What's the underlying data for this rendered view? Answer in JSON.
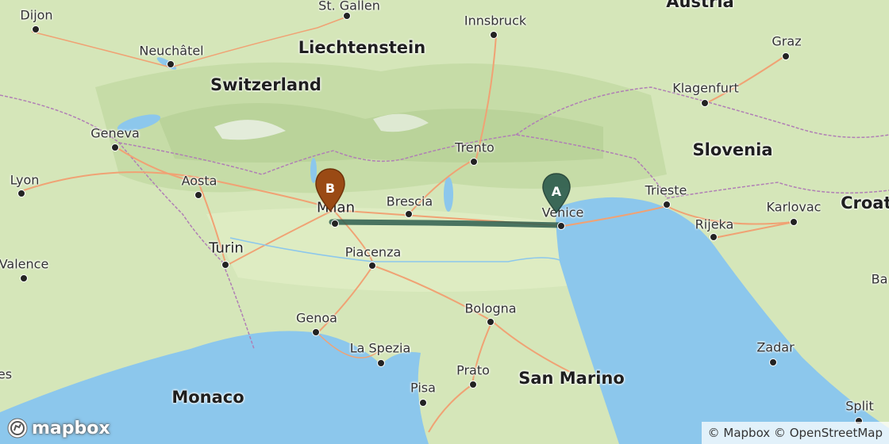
{
  "map": {
    "countries": [
      "Austria",
      "Liechtenstein",
      "Switzerland",
      "Slovenia",
      "Croatia",
      "San Marino",
      "Monaco"
    ],
    "cities": [
      "St. Gallen",
      "Innsbruck",
      "Dijon",
      "Neuchâtel",
      "Graz",
      "Klagenfurt",
      "Geneva",
      "Trento",
      "Lyon",
      "Aosta",
      "Brescia",
      "Trieste",
      "Karlovac",
      "Milan",
      "Venice",
      "Rijeka",
      "Turin",
      "Piacenza",
      "Valence",
      "Bologna",
      "Genoa",
      "La Spezia",
      "Zadar",
      "Prato",
      "Pisa",
      "Split",
      "Ba",
      "es"
    ],
    "route": {
      "from": "Venice",
      "to": "Milan",
      "color": "#2f5e4f"
    },
    "marker_a": {
      "label": "A",
      "color": "#2f5e4f"
    },
    "marker_b": {
      "label": "B",
      "color": "#9a4a14"
    },
    "logo_text": "mapbox",
    "attribution": "© Mapbox © OpenStreetMap"
  }
}
